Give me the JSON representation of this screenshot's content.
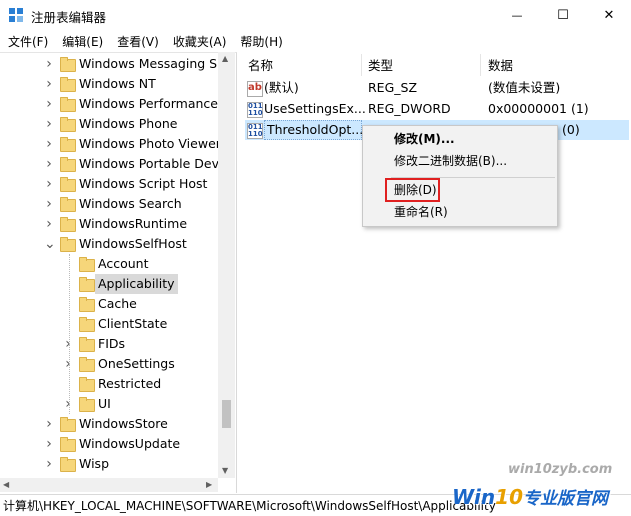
{
  "window": {
    "title": "注册表编辑器",
    "minimize_glyph": "—",
    "maximize_glyph": "☐",
    "close_glyph": "✕"
  },
  "menu": [
    "文件(F)",
    "编辑(E)",
    "查看(V)",
    "收藏夹(A)",
    "帮助(H)"
  ],
  "tree": {
    "items": [
      {
        "label": "Windows Messaging Su",
        "level": 0,
        "expander": ">"
      },
      {
        "label": "Windows NT",
        "level": 0,
        "expander": ">"
      },
      {
        "label": "Windows Performance T",
        "level": 0,
        "expander": ">"
      },
      {
        "label": "Windows Phone",
        "level": 0,
        "expander": ">"
      },
      {
        "label": "Windows Photo Viewer",
        "level": 0,
        "expander": ">"
      },
      {
        "label": "Windows Portable Devi",
        "level": 0,
        "expander": ">"
      },
      {
        "label": "Windows Script Host",
        "level": 0,
        "expander": ">"
      },
      {
        "label": "Windows Search",
        "level": 0,
        "expander": ">"
      },
      {
        "label": "WindowsRuntime",
        "level": 0,
        "expander": ">"
      },
      {
        "label": "WindowsSelfHost",
        "level": 0,
        "expander": "v"
      },
      {
        "label": "Account",
        "level": 1,
        "expander": ""
      },
      {
        "label": "Applicability",
        "level": 1,
        "expander": "",
        "selected": true
      },
      {
        "label": "Cache",
        "level": 1,
        "expander": ""
      },
      {
        "label": "ClientState",
        "level": 1,
        "expander": ""
      },
      {
        "label": "FIDs",
        "level": 1,
        "expander": ">"
      },
      {
        "label": "OneSettings",
        "level": 1,
        "expander": ">"
      },
      {
        "label": "Restricted",
        "level": 1,
        "expander": ""
      },
      {
        "label": "UI",
        "level": 1,
        "expander": ">"
      },
      {
        "label": "WindowsStore",
        "level": 0,
        "expander": ">"
      },
      {
        "label": "WindowsUpdate",
        "level": 0,
        "expander": ">"
      },
      {
        "label": "Wisp",
        "level": 0,
        "expander": ">"
      }
    ]
  },
  "list": {
    "headers": {
      "name": "名称",
      "type": "类型",
      "data": "数据"
    },
    "rows": [
      {
        "icon": "string-value-icon",
        "icon_text": "ab",
        "name": "(默认)",
        "type": "REG_SZ",
        "data": "(数值未设置)"
      },
      {
        "icon": "binary-value-icon",
        "icon_text": "011\n110",
        "name": "UseSettingsEx...",
        "type": "REG_DWORD",
        "data": "0x00000001 (1)"
      },
      {
        "icon": "binary-value-icon",
        "icon_text": "011\n110",
        "name": "ThresholdOpt...",
        "type": "",
        "data": "(0)",
        "selected": true
      }
    ]
  },
  "context_menu": {
    "modify": "修改(M)...",
    "modify_binary": "修改二进制数据(B)...",
    "delete": "删除(D)",
    "rename": "重命名(R)"
  },
  "status": "计算机\\HKEY_LOCAL_MACHINE\\SOFTWARE\\Microsoft\\WindowsSelfHost\\Applicability",
  "watermark": {
    "site": "win10zyb.com",
    "brand_prefix": "Win",
    "brand_num": "10",
    "brand_text": "专业版官网"
  },
  "colors": {
    "delete_highlight": "#e02020",
    "selection": "#cce8ff",
    "folder": "#f6d67a"
  }
}
